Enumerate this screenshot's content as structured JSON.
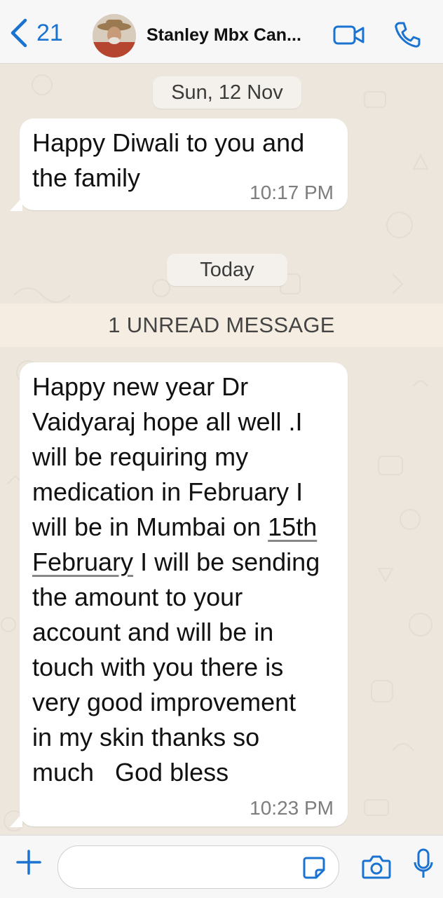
{
  "header": {
    "back_count": "21",
    "contact_name": "Stanley Mbx Can...",
    "accent_color": "#1a73d0"
  },
  "chat": {
    "date_separator_1": "Sun, 12 Nov",
    "message_1": {
      "line1": "Happy Diwali to you and",
      "line2": "the family",
      "time": "10:17 PM"
    },
    "date_separator_2": "Today",
    "unread_label": "1 UNREAD MESSAGE",
    "message_2": {
      "lines": [
        "Happy new year Dr",
        "Vaidyaraj hope all well .I",
        "will be requiring my",
        "medication in February  I",
        "will be in Mumbai on ",
        "15th",
        "February",
        " I will be sending",
        "the amount to your",
        "account and will be in",
        "touch with you there is",
        "very good improvement",
        "in my skin  thanks so",
        "much   God bless"
      ],
      "time": "10:23 PM"
    }
  },
  "input": {
    "placeholder": ""
  },
  "icons": {
    "back": "chevron-left-icon",
    "video": "video-camera-icon",
    "phone": "phone-icon",
    "plus": "plus-icon",
    "sticker": "sticker-icon",
    "camera": "camera-icon",
    "mic": "microphone-icon"
  }
}
